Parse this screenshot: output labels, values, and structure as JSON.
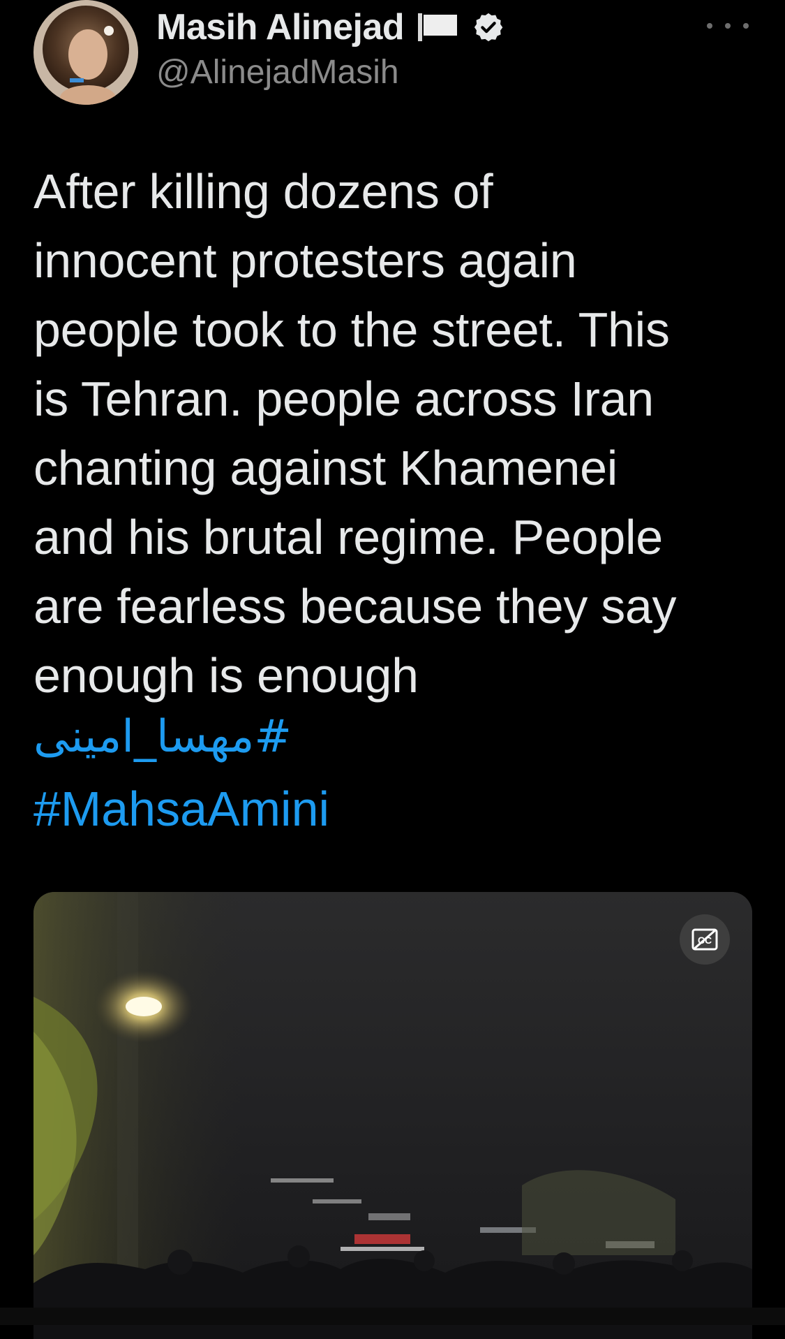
{
  "author": {
    "display_name": "Masih Alinejad",
    "handle": "@AlinejadMasih",
    "verified": true,
    "flag_icon": "white-flag-icon",
    "verified_icon": "verified-badge-icon"
  },
  "tweet": {
    "text_lines": [
      "After killing dozens of",
      "innocent protesters again",
      "people took to the street. This",
      "is Tehran. people across Iran",
      "chanting against Khamenei",
      "and his brutal regime.  People",
      "are fearless because they say",
      "enough is enough"
    ],
    "hashtags": [
      "#مهسا_امینی",
      "#MahsaAmini"
    ]
  },
  "media": {
    "type": "video",
    "captions_icon": "closed-captions-icon"
  },
  "menu": {
    "more_icon": "more-options-icon"
  },
  "colors": {
    "background": "#000000",
    "text": "#e7e9ea",
    "secondary_text": "#8b8b8b",
    "link": "#1d9bf0"
  }
}
